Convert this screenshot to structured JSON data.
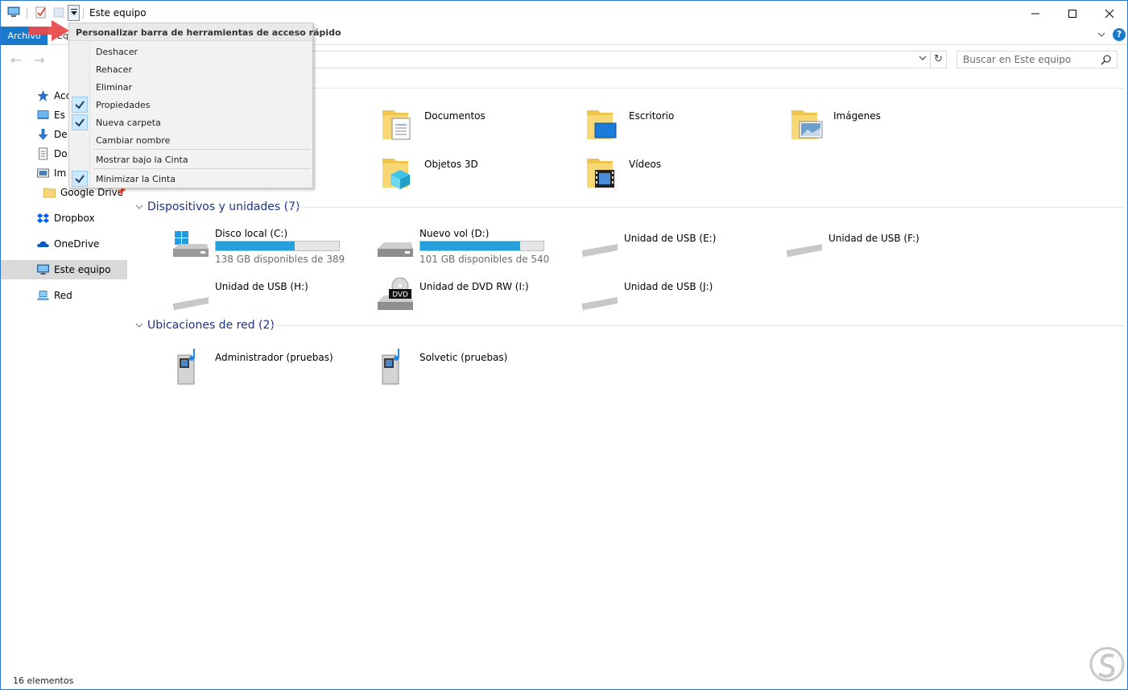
{
  "window": {
    "title": "Este equipo",
    "controls": [
      "minimize",
      "maximize",
      "close"
    ]
  },
  "ribbon": {
    "file_tab": "Archivo",
    "other_tab_partial": "Eq"
  },
  "address": {
    "search_placeholder": "Buscar en Este equipo"
  },
  "qat_menu": {
    "header": "Personalizar barra de herramientas de acceso rápido",
    "items": [
      {
        "label": "Deshacer",
        "checked": false
      },
      {
        "label": "Rehacer",
        "checked": false
      },
      {
        "label": "Eliminar",
        "checked": false
      },
      {
        "label": "Propiedades",
        "checked": true
      },
      {
        "label": "Nueva carpeta",
        "checked": true
      },
      {
        "label": "Cambiar nombre",
        "checked": false
      }
    ],
    "show_below": "Mostrar bajo la Cinta",
    "minimize": "Minimizar la Cinta",
    "minimize_checked": true
  },
  "sidebar": {
    "items": [
      {
        "label": "Acc",
        "icon": "star-icon"
      },
      {
        "label": "Es",
        "icon": "desktop-icon"
      },
      {
        "label": "De",
        "icon": "download-icon"
      },
      {
        "label": "Do",
        "icon": "document-icon"
      },
      {
        "label": "Im",
        "icon": "images-icon"
      },
      {
        "label": "Google Drive",
        "icon": "folder-icon"
      },
      {
        "label": "Dropbox",
        "icon": "dropbox-icon"
      },
      {
        "label": "OneDrive",
        "icon": "onedrive-icon"
      },
      {
        "label": "Este equipo",
        "icon": "computer-icon"
      },
      {
        "label": "Red",
        "icon": "network-icon"
      }
    ]
  },
  "folders": [
    {
      "name": "Documentos",
      "icon": "documents-folder-icon"
    },
    {
      "name": "Escritorio",
      "icon": "desktop-folder-icon"
    },
    {
      "name": "Imágenes",
      "icon": "pictures-folder-icon"
    },
    {
      "name": "Objetos 3D",
      "icon": "objects3d-folder-icon"
    },
    {
      "name": "Vídeos",
      "icon": "videos-folder-icon"
    }
  ],
  "devices": {
    "title": "Dispositivos y unidades (7)",
    "items": [
      {
        "name": "Disco local (C:)",
        "used_fraction": 0.64,
        "free": "138 GB disponibles de 389",
        "icon": "windows-drive-icon"
      },
      {
        "name": "Nuevo vol (D:)",
        "used_fraction": 0.81,
        "free": "101 GB disponibles de 540",
        "icon": "hard-drive-icon"
      },
      {
        "name": "Unidad de USB (E:)",
        "icon": "usb-drive-icon"
      },
      {
        "name": "Unidad de USB (F:)",
        "icon": "usb-drive-icon"
      },
      {
        "name": "Unidad de USB (H:)",
        "icon": "usb-drive-icon"
      },
      {
        "name": "Unidad de DVD RW (I:)",
        "icon": "dvd-drive-icon",
        "badge": "DVD"
      },
      {
        "name": "Unidad de USB (J:)",
        "icon": "usb-drive-icon"
      }
    ]
  },
  "network": {
    "title": "Ubicaciones de red (2)",
    "items": [
      {
        "name": "Administrador (pruebas)",
        "icon": "media-server-icon"
      },
      {
        "name": "Solvetic (pruebas)",
        "icon": "media-server-icon"
      }
    ]
  },
  "status": {
    "count": "16 elementos"
  },
  "colors": {
    "accent": "#1979ca",
    "progress": "#26a0da",
    "group_header": "#1e3287",
    "annotation_arrow": "#e84c4c"
  }
}
